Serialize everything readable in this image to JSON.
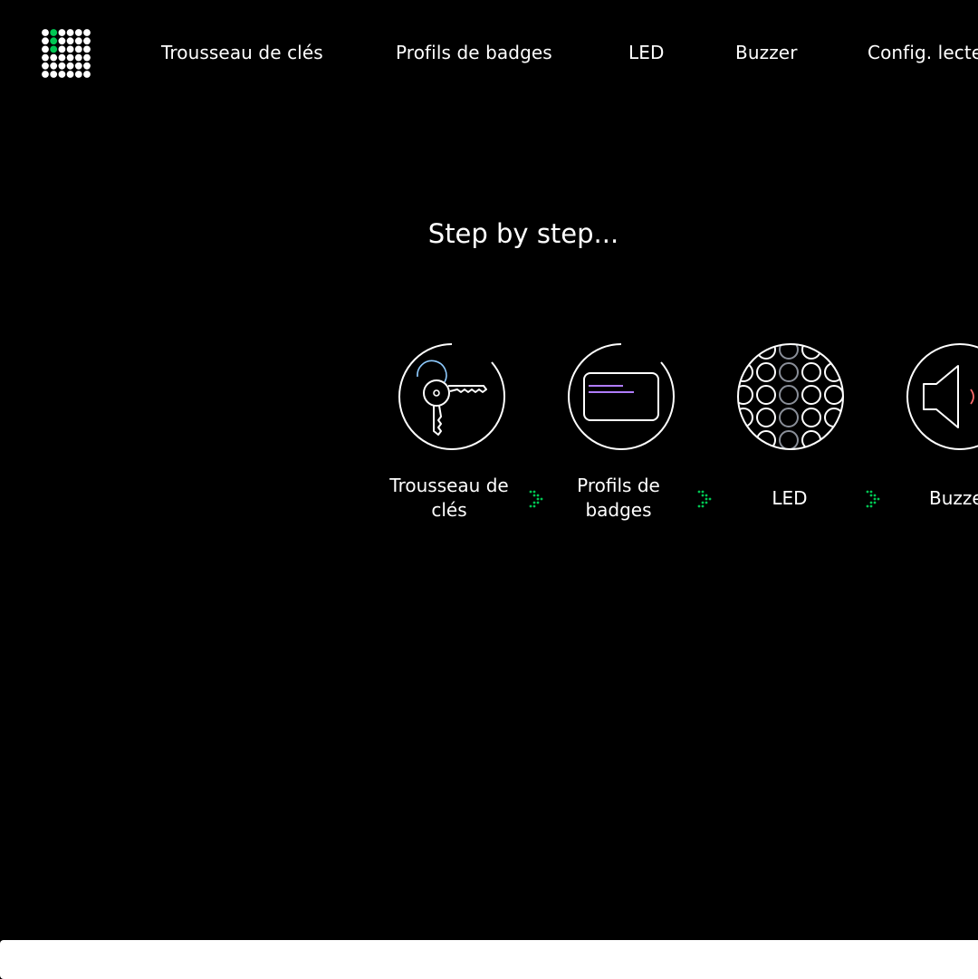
{
  "header": {
    "logo": {
      "icon": "dot-matrix-logo-icon",
      "color_dots": "#ffffff",
      "color_accent": "#00c853"
    },
    "nav": [
      {
        "label": "Trousseau de clés"
      },
      {
        "label": "Profils de badges"
      },
      {
        "label": "LED"
      },
      {
        "label": "Buzzer"
      },
      {
        "label": "Config. lecte"
      }
    ]
  },
  "main": {
    "title": "Step by step...",
    "steps": [
      {
        "label": "Trousseau de clés",
        "icon": "keys-icon"
      },
      {
        "label": "Profils de badges",
        "icon": "badge-card-icon"
      },
      {
        "label": "LED",
        "icon": "led-grid-icon"
      },
      {
        "label": "Buzze",
        "icon": "speaker-icon"
      }
    ],
    "arrow_icon": "dotted-chevron-right-icon"
  },
  "colors": {
    "background": "#000000",
    "text": "#ffffff",
    "accent_green": "#00c853",
    "key_ring_blue": "#8ecbff",
    "badge_purple": "#b07cff",
    "led_gray": "#8a8f99",
    "buzzer_red": "#ff6b6b"
  }
}
